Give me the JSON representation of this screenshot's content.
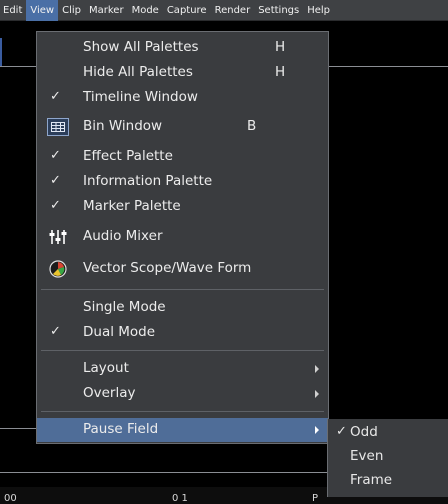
{
  "menubar": {
    "items": [
      {
        "label": "Edit"
      },
      {
        "label": "View"
      },
      {
        "label": "Clip"
      },
      {
        "label": "Marker"
      },
      {
        "label": "Mode"
      },
      {
        "label": "Capture"
      },
      {
        "label": "Render"
      },
      {
        "label": "Settings"
      },
      {
        "label": "Help"
      }
    ],
    "active": "View"
  },
  "view_menu": {
    "items": [
      {
        "label": "Show All Palettes",
        "shortcut": "H",
        "checked": false
      },
      {
        "label": "Hide All Palettes",
        "shortcut": "H",
        "checked": false
      },
      {
        "label": "Timeline Window",
        "checked": true
      },
      {
        "label": "Bin Window",
        "shortcut": "B",
        "icon": "bin-window-icon"
      },
      {
        "label": "Effect Palette",
        "checked": true
      },
      {
        "label": "Information  Palette",
        "checked": true
      },
      {
        "label": "Marker Palette",
        "checked": true
      },
      {
        "label": "Audio Mixer",
        "icon": "audio-mixer-icon"
      },
      {
        "label": "Vector Scope/Wave Form",
        "icon": "vector-scope-icon"
      },
      {
        "label": "Single Mode",
        "checked": false
      },
      {
        "label": "Dual Mode",
        "checked": true
      },
      {
        "label": "Layout",
        "submenu": true
      },
      {
        "label": "Overlay",
        "submenu": true
      },
      {
        "label": "Pause Field",
        "submenu": true,
        "highlighted": true
      }
    ]
  },
  "pause_field_submenu": {
    "items": [
      {
        "label": "Odd",
        "checked": true
      },
      {
        "label": "Even",
        "checked": false
      },
      {
        "label": "Frame",
        "checked": false
      }
    ]
  },
  "status_strip": {
    "items": [
      "00",
      "0 1",
      "P"
    ]
  },
  "colors": {
    "menu_bg": "#3a3c3f",
    "highlight": "#4f6d98",
    "menubar_bg": "#3f4144",
    "active_menu": "#4a6fa6"
  }
}
